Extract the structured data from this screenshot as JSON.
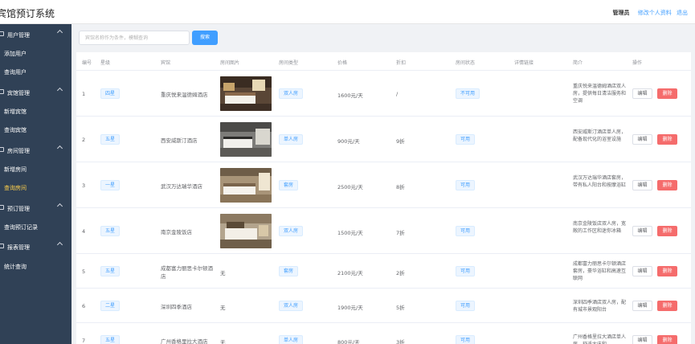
{
  "header": {
    "title": "宾馆预订系统",
    "user": "管理员",
    "edit_profile": "修改个人资料",
    "logout": "退出"
  },
  "sidebar": {
    "groups": [
      {
        "label": "用户管理",
        "icon": "user-icon",
        "items": [
          "添加用户",
          "查询用户"
        ]
      },
      {
        "label": "宾馆管理",
        "icon": "building-icon",
        "items": [
          "新增宾馆",
          "查询宾馆"
        ]
      },
      {
        "label": "房间管理",
        "icon": "home-icon",
        "items": [
          "新增房间",
          "查询房间"
        ]
      },
      {
        "label": "预订管理",
        "icon": "document-icon",
        "items": [
          "查询预订记录"
        ]
      },
      {
        "label": "报表管理",
        "icon": "chart-icon",
        "items": [
          "统计查询"
        ]
      }
    ],
    "active_item": "查询房间",
    "active_color": "#ffd04b"
  },
  "search": {
    "placeholder": "宾馆名称作为条件，模糊查询",
    "button": "搜索"
  },
  "table": {
    "columns": [
      "编号",
      "星级",
      "宾馆",
      "房间图片",
      "房间类型",
      "价格",
      "折扣",
      "房间状态",
      "详情链接",
      "简介",
      "操作"
    ],
    "edit_label": "编辑",
    "delete_label": "删除",
    "no_image_text": "无",
    "rows": [
      {
        "id": "1",
        "star": "四星",
        "hotel": "重庆悦来温德姆酒店",
        "room_type": "双人房",
        "price": "1600元/天",
        "discount": "/",
        "status": "不可用",
        "desc": "重庆悦来温德姆酒店双人房，提供每日清洁服务和空调",
        "has_image": true
      },
      {
        "id": "2",
        "star": "五星",
        "hotel": "西安威斯汀酒店",
        "room_type": "单人房",
        "price": "900元/天",
        "discount": "9折",
        "status": "可用",
        "desc": "西安威斯汀酒店单人房，配备现代化的浴室设施",
        "has_image": true
      },
      {
        "id": "3",
        "star": "一星",
        "hotel": "武汉万达瑞华酒店",
        "room_type": "套房",
        "price": "2500元/天",
        "discount": "8折",
        "status": "可用",
        "desc": "武汉万达瑞华酒店套房，带有私人阳台和按摩浴缸",
        "has_image": true
      },
      {
        "id": "4",
        "star": "五星",
        "hotel": "南京金陵饭店",
        "room_type": "双人房",
        "price": "1500元/天",
        "discount": "7折",
        "status": "可用",
        "desc": "南京金陵饭店双人房，宽敞的工作区和迷你冰箱",
        "has_image": true
      },
      {
        "id": "5",
        "star": "五星",
        "hotel": "成都富力丽思卡尔顿酒店",
        "room_type": "套房",
        "price": "2100元/天",
        "discount": "2折",
        "status": "可用",
        "desc": "成都富力丽思卡尔顿酒店套房，豪华浴缸和高速互联网",
        "has_image": false
      },
      {
        "id": "6",
        "star": "二星",
        "hotel": "深圳四季酒店",
        "room_type": "双人房",
        "price": "1900元/天",
        "discount": "5折",
        "status": "可用",
        "desc": "深圳四季酒店双人房，配有城市景观阳台",
        "has_image": false
      },
      {
        "id": "7",
        "star": "五星",
        "hotel": "广州香格里拉大酒店",
        "room_type": "单人房",
        "price": "800元/天",
        "discount": "3折",
        "status": "可用",
        "desc": "广州香格里拉大酒店单人房，舒适大床和",
        "has_image": false
      }
    ]
  },
  "colors": {
    "sidebar_bg": "#304156",
    "primary": "#409eff",
    "danger": "#f56c6c"
  }
}
